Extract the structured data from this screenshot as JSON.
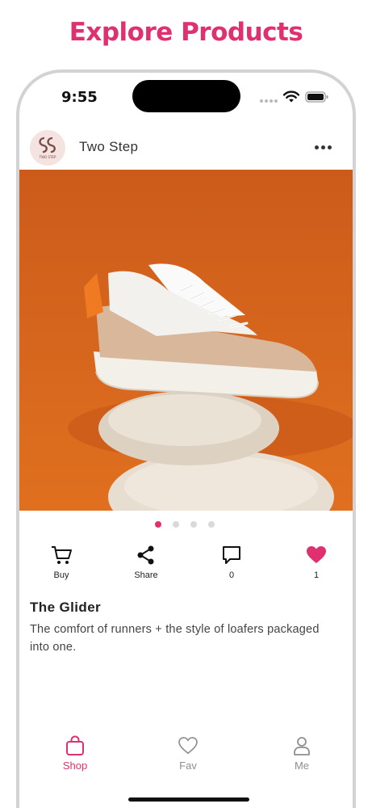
{
  "headline": "Explore Products",
  "colors": {
    "accent": "#e0306f",
    "image_background": "#d7601c",
    "inactive": "#8e8e93"
  },
  "status_bar": {
    "time": "9:55",
    "icons": [
      "signal-dots-icon",
      "wifi-icon",
      "battery-icon"
    ]
  },
  "header": {
    "brand_name": "Two Step",
    "avatar_text": "TWO STEP",
    "menu_icon": "more-dots-icon"
  },
  "product": {
    "image": "sneaker-on-stones",
    "carousel": {
      "count": 4,
      "active_index": 0
    },
    "title": "The Glider",
    "description": "The comfort of runners + the style of loafers packaged into one."
  },
  "actions": [
    {
      "icon": "cart-icon",
      "label": "Buy"
    },
    {
      "icon": "share-icon",
      "label": "Share"
    },
    {
      "icon": "comment-icon",
      "label": "0"
    },
    {
      "icon": "heart-icon",
      "label": "1"
    }
  ],
  "tabs": [
    {
      "icon": "shopping-bag-icon",
      "label": "Shop",
      "active": true
    },
    {
      "icon": "heart-outline-icon",
      "label": "Fav",
      "active": false
    },
    {
      "icon": "person-icon",
      "label": "Me",
      "active": false
    }
  ]
}
